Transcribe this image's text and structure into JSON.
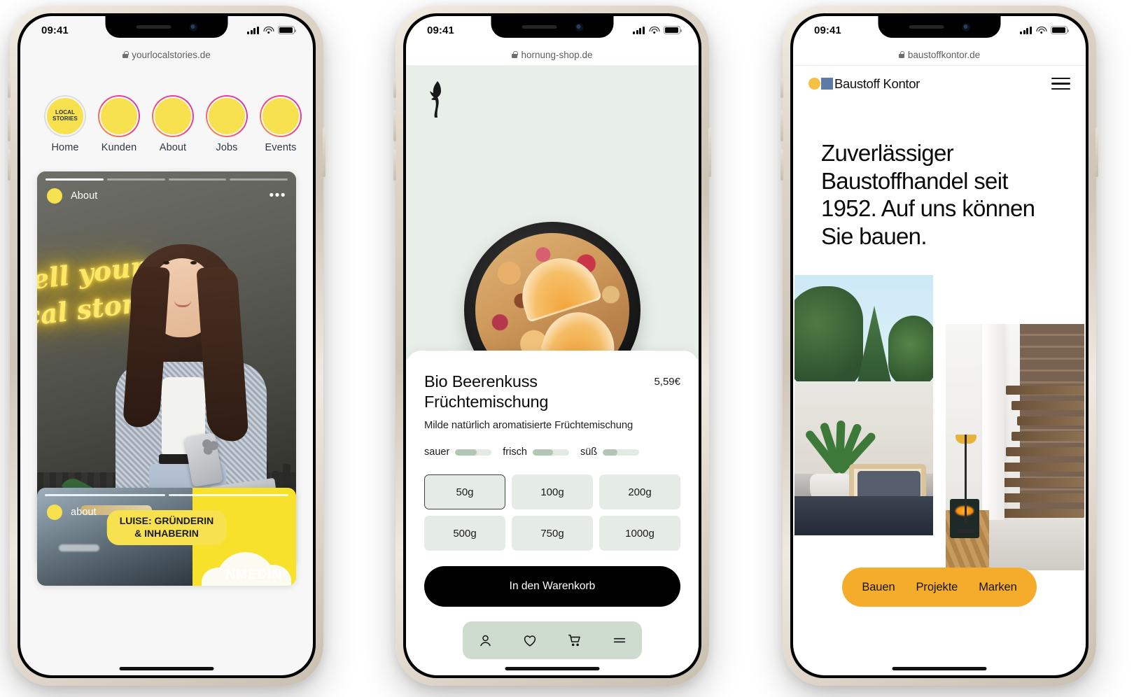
{
  "phones": [
    {
      "id": "phone-1",
      "status": {
        "time": "09:41",
        "signal_icon": "cellular-bars-icon",
        "wifi_icon": "wifi-icon",
        "battery_icon": "battery-icon"
      },
      "url": "yourlocalstories.de",
      "stories": [
        {
          "label": "Home",
          "badge": "LOCAL\nSTORIES",
          "seen": true
        },
        {
          "label": "Kunden",
          "badge": "",
          "seen": false
        },
        {
          "label": "About",
          "badge": "",
          "seen": false
        },
        {
          "label": "Jobs",
          "badge": "",
          "seen": false
        },
        {
          "label": "Events",
          "badge": "",
          "seen": false
        }
      ],
      "story_card": {
        "username": "About",
        "menu_icon": "more-dots-icon",
        "neon_text_line1": "tell your",
        "neon_text_line2": "cal story",
        "caption_line1": "LUISE: GRÜNDERIN",
        "caption_line2": "& INHABERIN",
        "progress_segments": 4,
        "active_segment": 1
      },
      "story_card_2": {
        "username": "about",
        "overlay_text": "NMEDIN",
        "progress_segments": 2
      }
    },
    {
      "id": "phone-2",
      "status": {
        "time": "09:41",
        "signal_icon": "cellular-bars-icon",
        "wifi_icon": "wifi-icon",
        "battery_icon": "battery-icon"
      },
      "url": "hornung-shop.de",
      "logo_icon": "face-profile-logo-icon",
      "product": {
        "title": "Bio Beerenkuss Früchtemischung",
        "price": "5,59€",
        "subtitle": "Milde natürlich aromatisierte Früchtemischung",
        "image_alt": "bowl-of-dried-fruit-tea-mix",
        "tastes": [
          {
            "label": "sauer",
            "fill": 60
          },
          {
            "label": "frisch",
            "fill": 55
          },
          {
            "label": "süß",
            "fill": 40
          }
        ],
        "sizes": [
          {
            "label": "50g",
            "selected": true
          },
          {
            "label": "100g",
            "selected": false
          },
          {
            "label": "200g",
            "selected": false
          },
          {
            "label": "500g",
            "selected": false
          },
          {
            "label": "750g",
            "selected": false
          },
          {
            "label": "1000g",
            "selected": false
          }
        ],
        "cart_button": "In den Warenkorb"
      },
      "tabbar": [
        {
          "icon": "account-person-icon"
        },
        {
          "icon": "heart-wishlist-icon"
        },
        {
          "icon": "shopping-cart-icon"
        },
        {
          "icon": "menu-lines-icon"
        }
      ]
    },
    {
      "id": "phone-3",
      "status": {
        "time": "09:41",
        "signal_icon": "cellular-bars-icon",
        "wifi_icon": "wifi-icon",
        "battery_icon": "battery-icon"
      },
      "url": "baustoffkontor.de",
      "brand": "Baustoff Kontor",
      "menu_icon": "hamburger-menu-icon",
      "headline": "Zuverlässiger Baustoffhandel seit 1952. Auf uns können Sie bauen.",
      "images": [
        {
          "alt": "outdoor-terrace-with-armchair-and-plants"
        },
        {
          "alt": "interior-staircase-with-wood-steps"
        }
      ],
      "nav_pill": [
        {
          "label": "Bauen"
        },
        {
          "label": "Projekte"
        },
        {
          "label": "Marken"
        }
      ]
    }
  ],
  "colors": {
    "story_yellow": "#f7e14f",
    "mint": "#e8efe8",
    "mint_chip": "#e5ebe5",
    "tabbar_green": "#cedbcf",
    "amber_pill": "#f5ac2b",
    "logo_dot": "#f5c043",
    "logo_square": "#5c7ba6",
    "black": "#000000"
  }
}
